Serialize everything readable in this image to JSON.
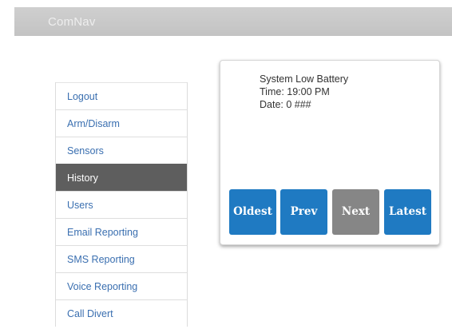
{
  "app": {
    "title": "ComNav"
  },
  "sidebar": {
    "items": [
      {
        "label": "Logout",
        "active": false
      },
      {
        "label": "Arm/Disarm",
        "active": false
      },
      {
        "label": "Sensors",
        "active": false
      },
      {
        "label": "History",
        "active": true
      },
      {
        "label": "Users",
        "active": false
      },
      {
        "label": "Email Reporting",
        "active": false
      },
      {
        "label": "SMS Reporting",
        "active": false
      },
      {
        "label": "Voice Reporting",
        "active": false
      },
      {
        "label": "Call Divert",
        "active": false
      }
    ]
  },
  "event": {
    "title": "System Low Battery",
    "time": "Time: 19:00 PM",
    "date": "Date: 0 ###"
  },
  "nav_buttons": {
    "oldest": "Oldest",
    "prev": "Prev",
    "next": "Next",
    "latest": "Latest"
  },
  "colors": {
    "header_bg": "#c8c8c8",
    "link": "#3a6fb0",
    "active_bg": "#5e5e5e",
    "button_blue": "#1f7ac2",
    "button_disabled": "#868686"
  }
}
